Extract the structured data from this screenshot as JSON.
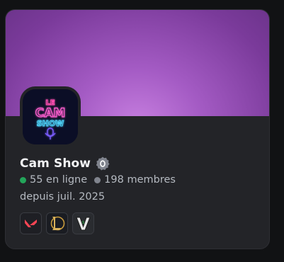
{
  "server": {
    "name": "Cam Show",
    "logo_text": [
      "LE",
      "CAM",
      "SHOW"
    ],
    "online_count": "55 en ligne",
    "member_count": "198 membres",
    "since": "depuis juil. 2025"
  },
  "games": [
    {
      "name": "valorant-icon"
    },
    {
      "name": "league-of-legends-icon"
    },
    {
      "name": "gta-v-icon"
    }
  ],
  "colors": {
    "online": "#23a55a",
    "members": "#80848e",
    "banner": "#a45bc4"
  }
}
